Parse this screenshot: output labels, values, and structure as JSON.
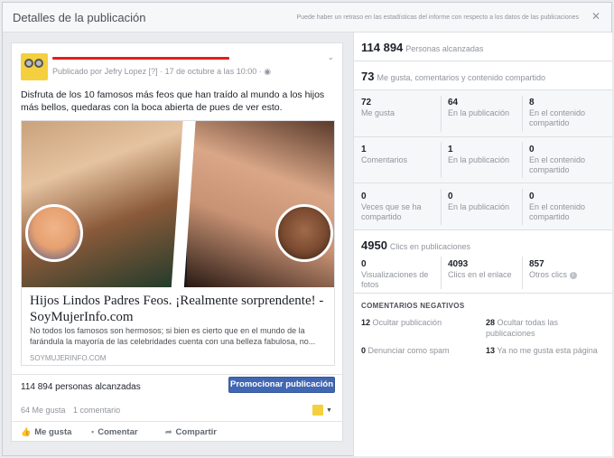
{
  "header": {
    "title": "Detalles de la publicación",
    "note": "Puede haber un retraso en las estadísticas del informe con respecto a los datos de las publicaciones",
    "close": "✕"
  },
  "post": {
    "published_by_prefix": "Publicado por",
    "author": "Jefry Lopez",
    "help_mark": "[?]",
    "date": "· 17 de octubre a las 10:00 ·",
    "text": "Disfruta de los 10 famosos más feos que han traído al mundo a los hijos más bellos, quedaras con la boca abierta de pues de ver esto.",
    "link": {
      "title": "Hijos Lindos Padres Feos. ¡Realmente sorprendente! - SoyMujerInfo.com",
      "description": "No todos los famosos son hermosos; si bien es cierto que en el mundo de la farándula la mayoría de las celebridades cuenta con una belleza fabulosa, no...",
      "domain": "SOYMUJERINFO.COM"
    },
    "reach_text": "114 894 personas alcanzadas",
    "promote_label": "Promocionar publicación",
    "likes_label": "64 Me gusta",
    "comments_label": "1 comentario",
    "actions": {
      "like": "Me gusta",
      "comment": "Comentar",
      "share": "Compartir"
    }
  },
  "insights": {
    "reach": {
      "value": "114 894",
      "label": "Personas alcanzadas"
    },
    "engagement": {
      "value": "73",
      "label": "Me gusta, comentarios y contenido compartido"
    },
    "grid": [
      [
        {
          "value": "72",
          "label": "Me gusta"
        },
        {
          "value": "64",
          "label": "En la publicación"
        },
        {
          "value": "8",
          "label": "En el contenido compartido"
        }
      ],
      [
        {
          "value": "1",
          "label": "Comentarios"
        },
        {
          "value": "1",
          "label": "En la publicación"
        },
        {
          "value": "0",
          "label": "En el contenido compartido"
        }
      ],
      [
        {
          "value": "0",
          "label": "Veces que se ha compartido"
        },
        {
          "value": "0",
          "label": "En la publicación"
        },
        {
          "value": "0",
          "label": "En el contenido compartido"
        }
      ]
    ],
    "clicks": {
      "value": "4950",
      "label": "Clics en publicaciones"
    },
    "click_breakdown": [
      {
        "value": "0",
        "label": "Visualizaciones de fotos"
      },
      {
        "value": "4093",
        "label": "Clics en el enlace"
      },
      {
        "value": "857",
        "label": "Otros clics"
      }
    ],
    "negative": {
      "heading": "COMENTARIOS NEGATIVOS",
      "items": [
        {
          "value": "12",
          "label": "Ocultar publicación"
        },
        {
          "value": "28",
          "label": "Ocultar todas las publicaciones"
        },
        {
          "value": "0",
          "label": "Denunciar como spam"
        },
        {
          "value": "13",
          "label": "Ya no me gusta esta página"
        }
      ]
    }
  },
  "colors": {
    "brand": "#4267b2",
    "redaction": "#e0201c"
  }
}
